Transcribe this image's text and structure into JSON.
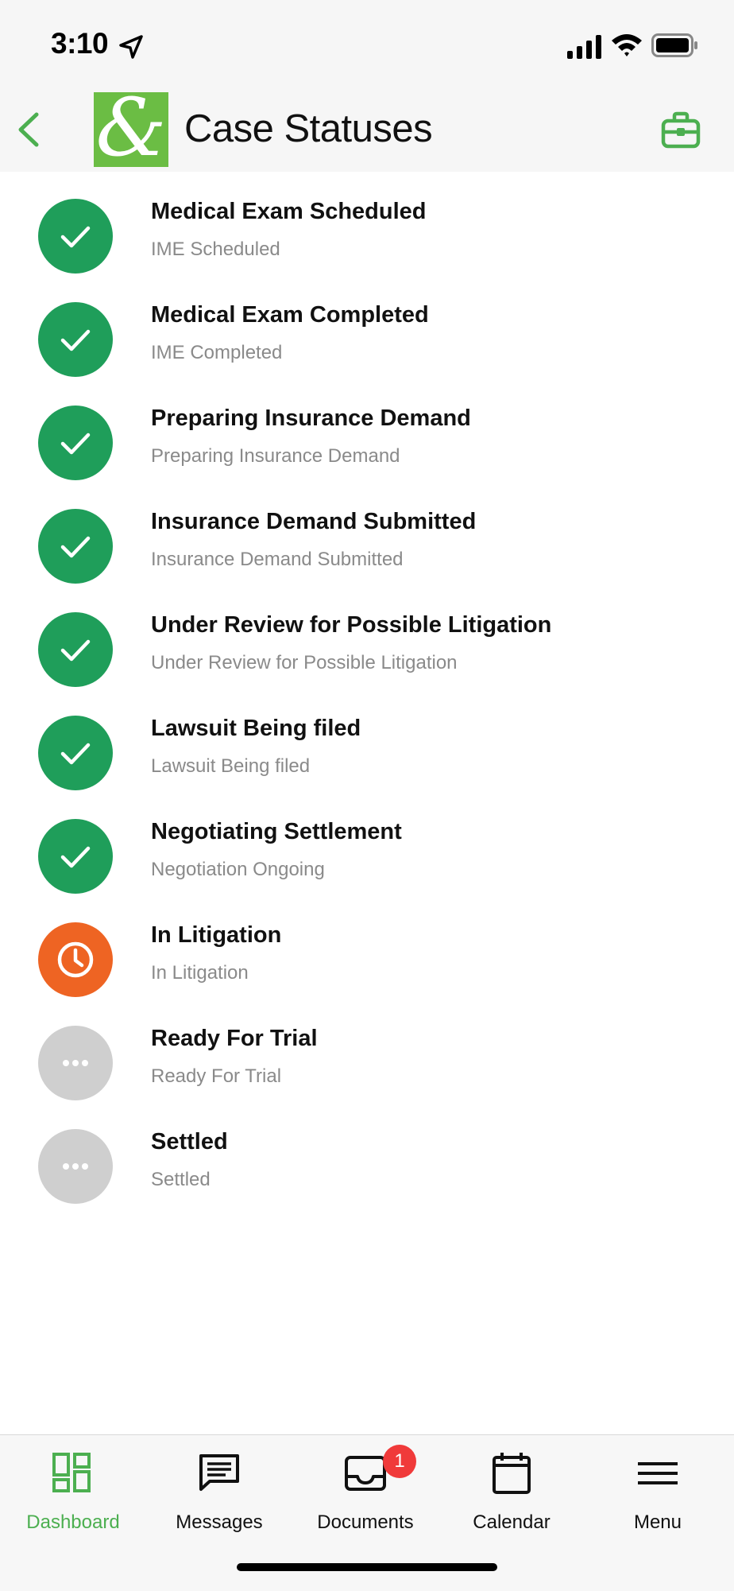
{
  "status_bar": {
    "time": "3:10"
  },
  "header": {
    "title": "Case Statuses",
    "logo_text": "&"
  },
  "colors": {
    "completed": "#1f9e5a",
    "in_progress": "#ee6423",
    "pending": "#cfcfcf",
    "accent": "#4caf50",
    "badge": "#f03a3a"
  },
  "statuses": [
    {
      "title": "Medical Exam Scheduled",
      "subtitle": "IME Scheduled",
      "state": "completed",
      "icon": "check-icon"
    },
    {
      "title": "Medical Exam Completed",
      "subtitle": "IME Completed",
      "state": "completed",
      "icon": "check-icon"
    },
    {
      "title": "Preparing Insurance Demand",
      "subtitle": "Preparing Insurance Demand",
      "state": "completed",
      "icon": "check-icon"
    },
    {
      "title": "Insurance Demand Submitted",
      "subtitle": "Insurance Demand Submitted",
      "state": "completed",
      "icon": "check-icon"
    },
    {
      "title": "Under Review for Possible Litigation",
      "subtitle": "Under Review for Possible Litigation",
      "state": "completed",
      "icon": "check-icon"
    },
    {
      "title": "Lawsuit Being filed",
      "subtitle": "Lawsuit Being filed",
      "state": "completed",
      "icon": "check-icon"
    },
    {
      "title": "Negotiating Settlement",
      "subtitle": "Negotiation Ongoing",
      "state": "completed",
      "icon": "check-icon"
    },
    {
      "title": "In Litigation",
      "subtitle": "In Litigation",
      "state": "in_progress",
      "icon": "clock-icon"
    },
    {
      "title": "Ready For Trial",
      "subtitle": "Ready For Trial",
      "state": "pending",
      "icon": "more-dots-icon"
    },
    {
      "title": "Settled",
      "subtitle": "Settled",
      "state": "pending",
      "icon": "more-dots-icon"
    }
  ],
  "tabs": [
    {
      "label": "Dashboard",
      "icon": "dashboard-icon",
      "active": true
    },
    {
      "label": "Messages",
      "icon": "chat-icon",
      "active": false
    },
    {
      "label": "Documents",
      "icon": "inbox-icon",
      "active": false,
      "badge": "1"
    },
    {
      "label": "Calendar",
      "icon": "calendar-icon",
      "active": false
    },
    {
      "label": "Menu",
      "icon": "hamburger-icon",
      "active": false
    }
  ]
}
